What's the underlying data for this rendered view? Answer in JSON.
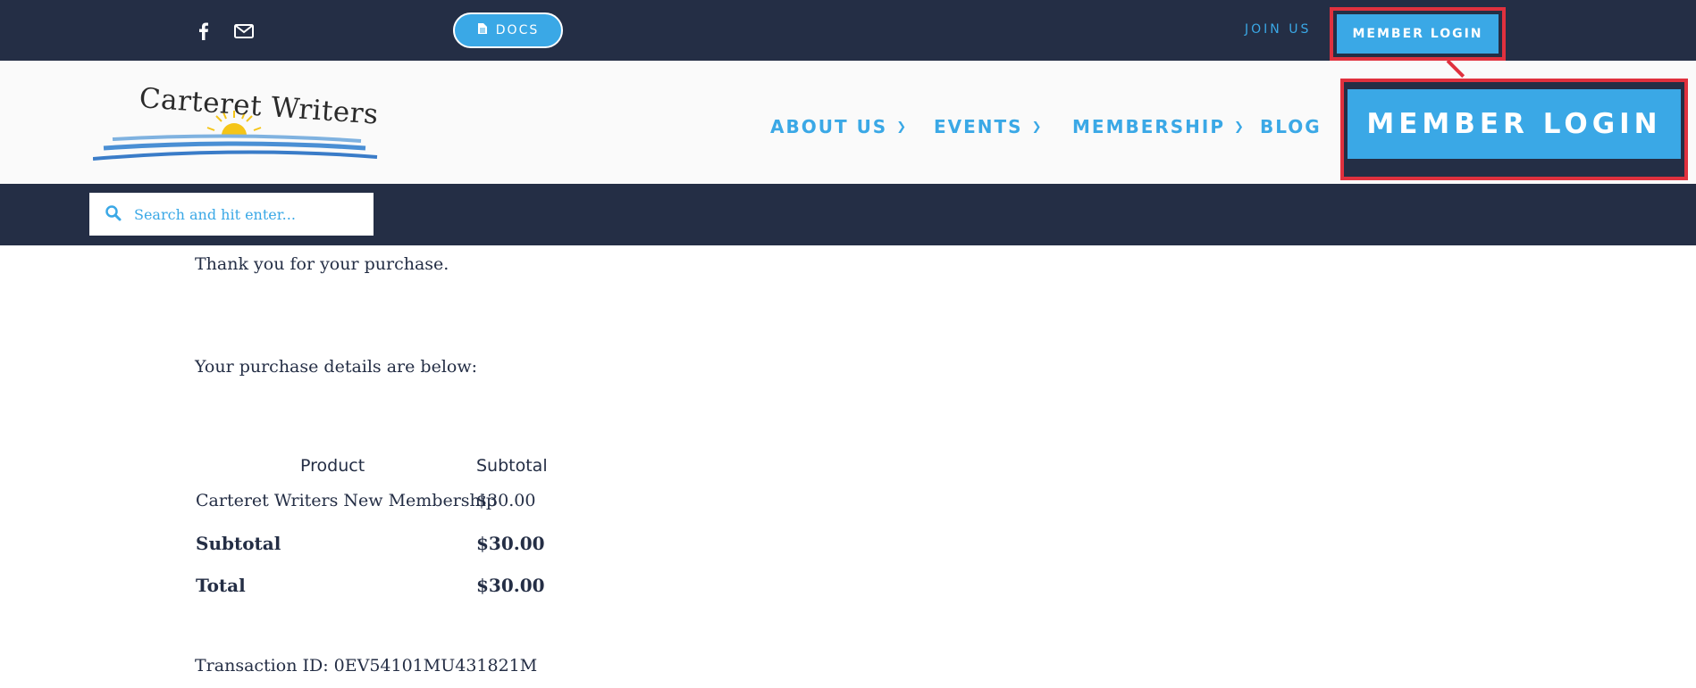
{
  "topbar": {
    "icons": [
      "facebook-icon",
      "envelope-icon"
    ],
    "docs_label": "DOCS",
    "join_label": "JOIN US",
    "member_login_label": "MEMBER LOGIN"
  },
  "header": {
    "logo_text": "Carteret Writers",
    "nav": [
      {
        "label": "ABOUT US",
        "has_dropdown": true
      },
      {
        "label": "EVENTS",
        "has_dropdown": true
      },
      {
        "label": "MEMBERSHIP",
        "has_dropdown": true
      },
      {
        "label": "BLOG",
        "has_dropdown": false
      }
    ],
    "member_login_label": "MEMBER LOGIN"
  },
  "search": {
    "placeholder": "Search and hit enter...",
    "value": ""
  },
  "main": {
    "thank_you": "Thank you for your purchase.",
    "details_intro": "Your purchase details are below:",
    "table": {
      "headers": [
        "Product",
        "Subtotal"
      ],
      "rows": [
        {
          "product": "Carteret Writers New Membership",
          "subtotal": "$30.00"
        }
      ],
      "subtotal_label": "Subtotal",
      "subtotal_value": "$30.00",
      "total_label": "Total",
      "total_value": "$30.00"
    },
    "transaction": "Transaction ID: 0EV54101MU431821M"
  },
  "colors": {
    "navy": "#242e45",
    "accent": "#3aa8e6",
    "highlight": "#e0313e"
  }
}
